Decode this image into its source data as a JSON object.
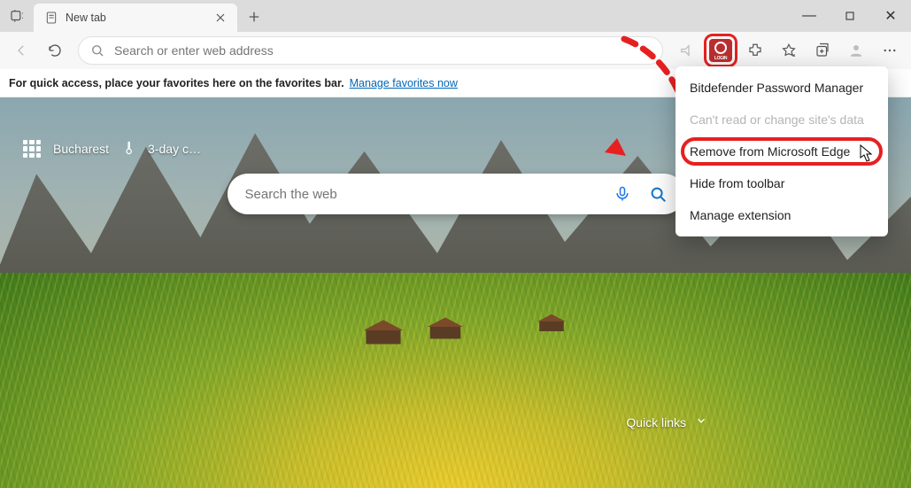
{
  "window": {
    "tab_title": "New tab",
    "minimize_glyph": "—",
    "maximize_glyph": "▢",
    "close_glyph": "✕"
  },
  "toolbar": {
    "address_placeholder": "Search or enter web address"
  },
  "favbar": {
    "hint": "For quick access, place your favorites here on the favorites bar.",
    "link": "Manage favorites now"
  },
  "ntp": {
    "location": "Bucharest",
    "forecast": "3-day c…",
    "search_placeholder": "Search the web",
    "quick_links_label": "Quick links"
  },
  "context_menu": {
    "title": "Bitdefender Password Manager",
    "cant_read": "Can't read or change site's data",
    "remove": "Remove from Microsoft Edge",
    "hide": "Hide from toolbar",
    "manage": "Manage extension"
  },
  "extension": {
    "label": "LOGIN"
  }
}
